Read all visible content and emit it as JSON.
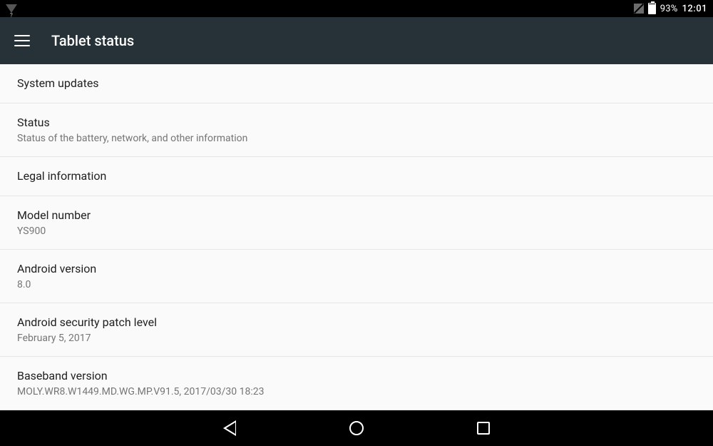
{
  "statusbar": {
    "battery_pct": "93%",
    "time": "12:01"
  },
  "appbar": {
    "title": "Tablet status"
  },
  "items": [
    {
      "label": "System updates",
      "sub": null
    },
    {
      "label": "Status",
      "sub": "Status of the battery, network, and other information"
    },
    {
      "label": "Legal information",
      "sub": null
    },
    {
      "label": "Model number",
      "sub": "YS900"
    },
    {
      "label": "Android version",
      "sub": "8.0"
    },
    {
      "label": "Android security patch level",
      "sub": "February 5, 2017"
    },
    {
      "label": "Baseband version",
      "sub": "MOLY.WR8.W1449.MD.WG.MP.V91.5, 2017/03/30 18:23"
    }
  ]
}
